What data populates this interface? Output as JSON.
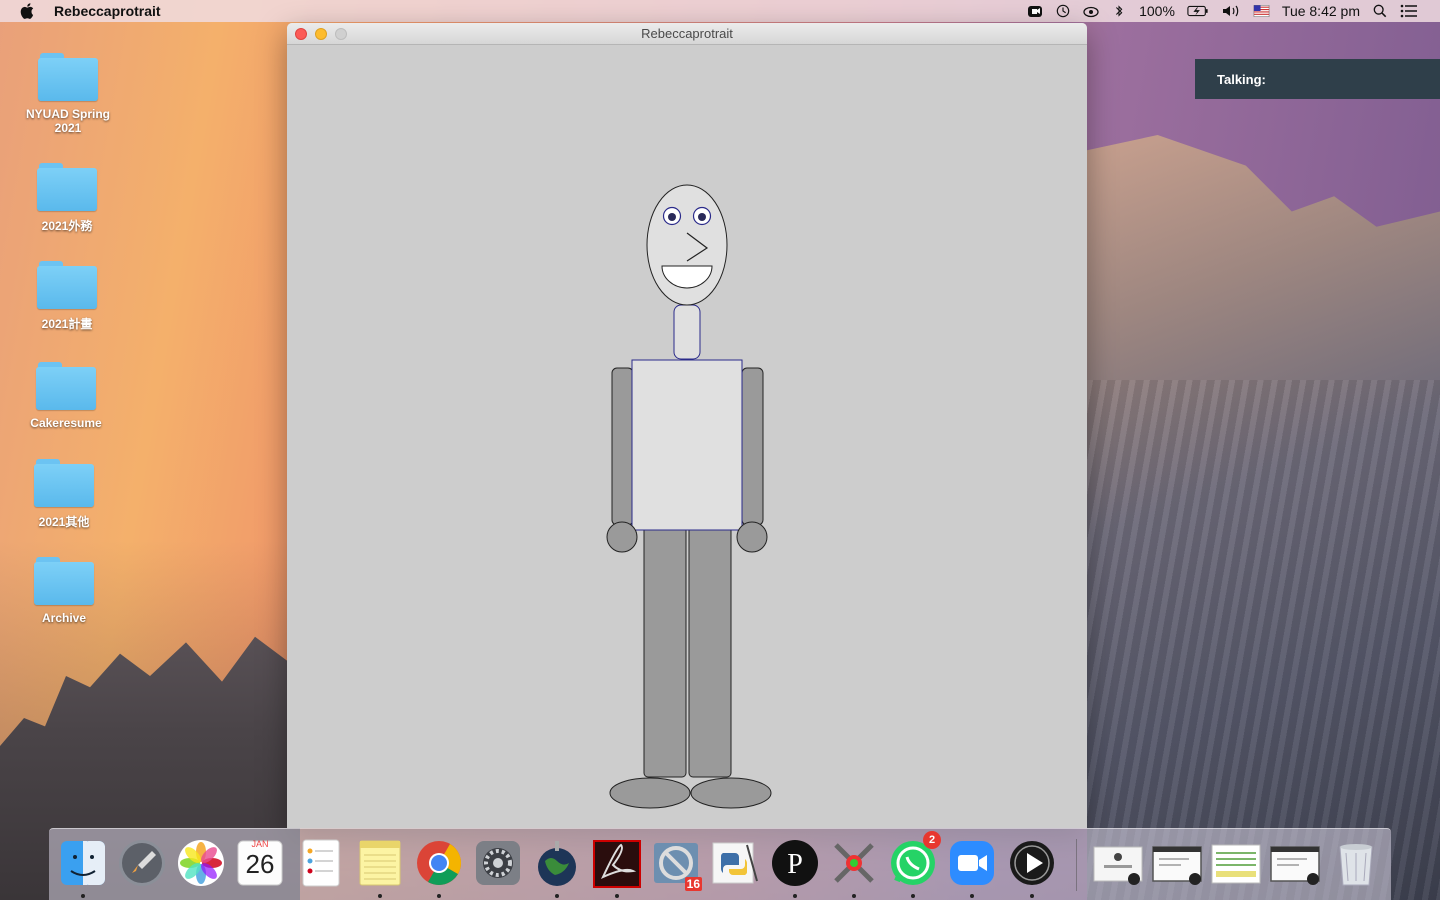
{
  "menubar": {
    "app_name": "Rebeccaprotrait",
    "battery": "100%",
    "datetime": "Tue 8:42 pm"
  },
  "desktop": {
    "items": [
      {
        "label": "NYUAD Spring 2021"
      },
      {
        "label": "2021外務"
      },
      {
        "label": "2021計畫"
      },
      {
        "label": "Cakeresume"
      },
      {
        "label": "2021其他"
      },
      {
        "label": "Archive"
      }
    ]
  },
  "window": {
    "title": "Rebeccaprotrait"
  },
  "notification": {
    "text": "Talking:"
  },
  "dock": {
    "calendar_month": "JAN",
    "calendar_day": "26",
    "whatsapp_badge": "2",
    "blocker_badge": "16",
    "apps": [
      "finder",
      "launchpad",
      "photos",
      "calendar",
      "reminders",
      "notes",
      "chrome",
      "system-preferences",
      "earth",
      "acrobat",
      "self-control",
      "python-idle",
      "p5",
      "color-picker",
      "whatsapp",
      "zoom",
      "quicktime"
    ]
  },
  "colors": {
    "canvas_bg": "#cdcdcd",
    "outline": "#2a2a8a",
    "limb_gray": "#9a9a9a",
    "torso_fill": "#e0e0e0",
    "notification_bg": "#2f3f4a"
  }
}
